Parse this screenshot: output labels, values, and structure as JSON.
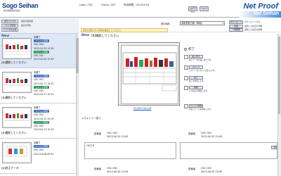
{
  "header": {
    "logo": "Sogo Seihan",
    "logo_sub": "総合製版株式会社",
    "login_label": "Login: OSC",
    "group_label": "Group: OSC",
    "date_label": "有効期限 : 2013/4/18",
    "brand": "Net Proof",
    "brand_sub": "Net Seihan",
    "button_1": "ログアウト",
    "button_2": "ヘルプ"
  },
  "left_tools": {
    "btn_1": "表示フォルダ",
    "btn_2": "フォルダ削除",
    "btn_3": "フォルダ名変更",
    "caption_1": "最新の更新順",
    "caption_2": "校正の登録"
  },
  "sidebar": {
    "items": [
      {
        "new": "New",
        "title": "[B]撮影してください",
        "status": "未確了",
        "pill_1": "ファイル登録",
        "meta_1": "OSC  OSC",
        "date_1": "2013.04.20 13:39",
        "pill_2": "コメント登録",
        "meta_2": "OSC  OSC",
        "date_2": "2013.04.20 13:40"
      },
      {
        "new": "",
        "title": "[B]撮影してください",
        "status": "未確了",
        "pill_1": "ファイル登録",
        "meta_1": "OSC  OSC",
        "date_1": "2013.04.17 15:22",
        "pill_2": "コメント登録",
        "meta_2": "OSC  OSC",
        "date_2": "2013.04.17 15:22"
      },
      {
        "new": "",
        "title": "[B]撮影してください",
        "status": "未確了",
        "pill_1": "ファイル登録",
        "meta_1": "OSC  OSC",
        "date_1": "2013.04.13 15:19",
        "pill_2": "コメント登録",
        "meta_2": "OSC  OSC",
        "date_2": "2013.04.13 15:19"
      },
      {
        "new": "",
        "title": "[B]修正データ",
        "status": "未確了",
        "pill_1": "ファイル登録",
        "meta_1": "OSC  OSC",
        "date_1": "2013.04.08 09:52",
        "pill_2": "",
        "meta_2": "",
        "date_2": ""
      }
    ]
  },
  "main": {
    "select_label": "表示順序",
    "select_value": "最新更新日順（降順）",
    "right_btn_1": "ダウンロード",
    "right_btn_2": "印刷",
    "right_btn_3": "一括削除",
    "mini_1": "ダウンロードする",
    "mini_2": "選択した校正を印刷",
    "mini_3": "選択した校正を削除",
    "notice": "最新に更新された内容を確認してください。",
    "new": "New",
    "title": "[B]撮影してください",
    "pdf_link": "0204572b.pdf",
    "approval": "校了",
    "actions": [
      {
        "btn": "差し替え",
        "note": "校正データを差し替えます。"
      },
      {
        "btn": "コメント",
        "note": "コメントを入力して送信します。"
      },
      {
        "btn": "校了",
        "note": "校了を登録します。"
      },
      {
        "btn": "削除",
        "note": "この校正を削除します。"
      },
      {
        "btn": "ファイル削除",
        "note": "添付ファイルを削除します。"
      }
    ],
    "comment_head": "<コメント一覧>",
    "comment": {
      "label_1": "投稿者",
      "user_1": "OSC  OSC",
      "date_1": "2013.04.20 13:40",
      "label_2": "投稿者",
      "user_2": "OSC  OSC",
      "date_2": "2013.04.20 13:40",
      "body": "OKです",
      "label_3": "投稿者",
      "user_3": "OSC  OSC",
      "date_3": "2013.04.20 13:39",
      "label_4": "投稿者",
      "user_4": "OSC  OSC",
      "date_4": "2013.04.20 13:39",
      "reply_btn": "返信"
    }
  }
}
